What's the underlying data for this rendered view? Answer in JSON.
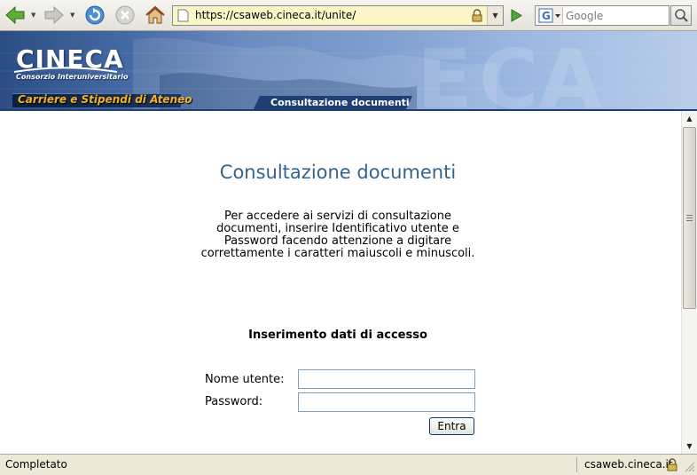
{
  "browser": {
    "url": "https://csaweb.cineca.it/unite/",
    "search_placeholder": "Google"
  },
  "banner": {
    "logo_text": "CINECA",
    "logo_subtitle": "Consorzio Interuniversitario",
    "tagline": "Carriere e Stipendi di Ateneo",
    "section_tab": "Consultazione documenti"
  },
  "content": {
    "title": "Consultazione documenti",
    "intro_lines": [
      "Per accedere ai servizi di consultazione",
      "documenti, inserire Identificativo utente e",
      "Password facendo attenzione a digitare",
      "correttamente i caratteri maiuscoli e minuscoli."
    ],
    "form": {
      "title": "Inserimento dati di accesso",
      "username_label": "Nome utente:",
      "username_value": "",
      "password_label": "Password:",
      "password_value": "",
      "submit_label": "Entra"
    }
  },
  "status": {
    "text": "Completato",
    "host": "csaweb.cineca.it"
  }
}
